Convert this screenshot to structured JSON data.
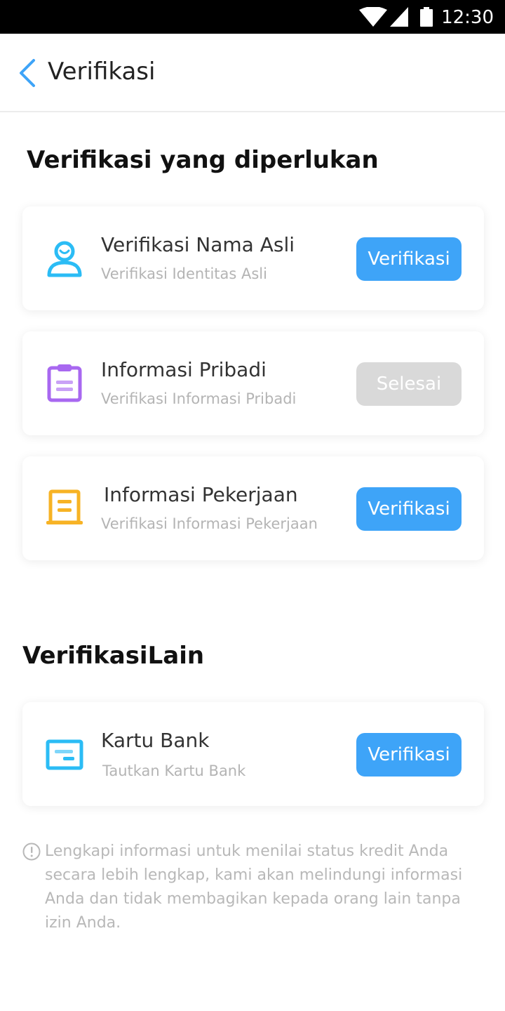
{
  "status_bar": {
    "time": "12:30"
  },
  "header": {
    "title": "Verifikasi"
  },
  "required_section": {
    "title": "Verifikasi yang diperlukan",
    "items": [
      {
        "title": "Verifikasi Nama Asli",
        "subtitle": "Verifikasi Identitas Asli",
        "button": "Verifikasi",
        "button_state": "active",
        "icon": "person-icon",
        "icon_color": "#2bbcf5"
      },
      {
        "title": "Informasi Pribadi",
        "subtitle": "Verifikasi Informasi Pribadi",
        "button": "Selesai",
        "button_state": "done",
        "icon": "clipboard-icon",
        "icon_color": "#a868f0"
      },
      {
        "title": "Informasi Pekerjaan",
        "subtitle": "Verifikasi Informasi Pekerjaan",
        "button": "Verifikasi",
        "button_state": "active",
        "icon": "document-icon",
        "icon_color": "#f7b325"
      }
    ]
  },
  "other_section": {
    "title": "VerifikasiLain",
    "items": [
      {
        "title": "Kartu Bank",
        "subtitle": "Tautkan Kartu Bank",
        "button": "Verifikasi",
        "button_state": "active",
        "icon": "bank-card-icon",
        "icon_color": "#2bbcf5"
      }
    ]
  },
  "notice": {
    "icon": "info-icon",
    "text": "Lengkapi informasi untuk menilai status kredit Anda secara lebih lengkap, kami akan melindungi informasi Anda dan tidak membagikan kepada orang lain tanpa izin Anda."
  },
  "colors": {
    "primary": "#3ea4f8",
    "disabled": "#d9d9d9",
    "back_arrow": "#3ea4f8"
  }
}
